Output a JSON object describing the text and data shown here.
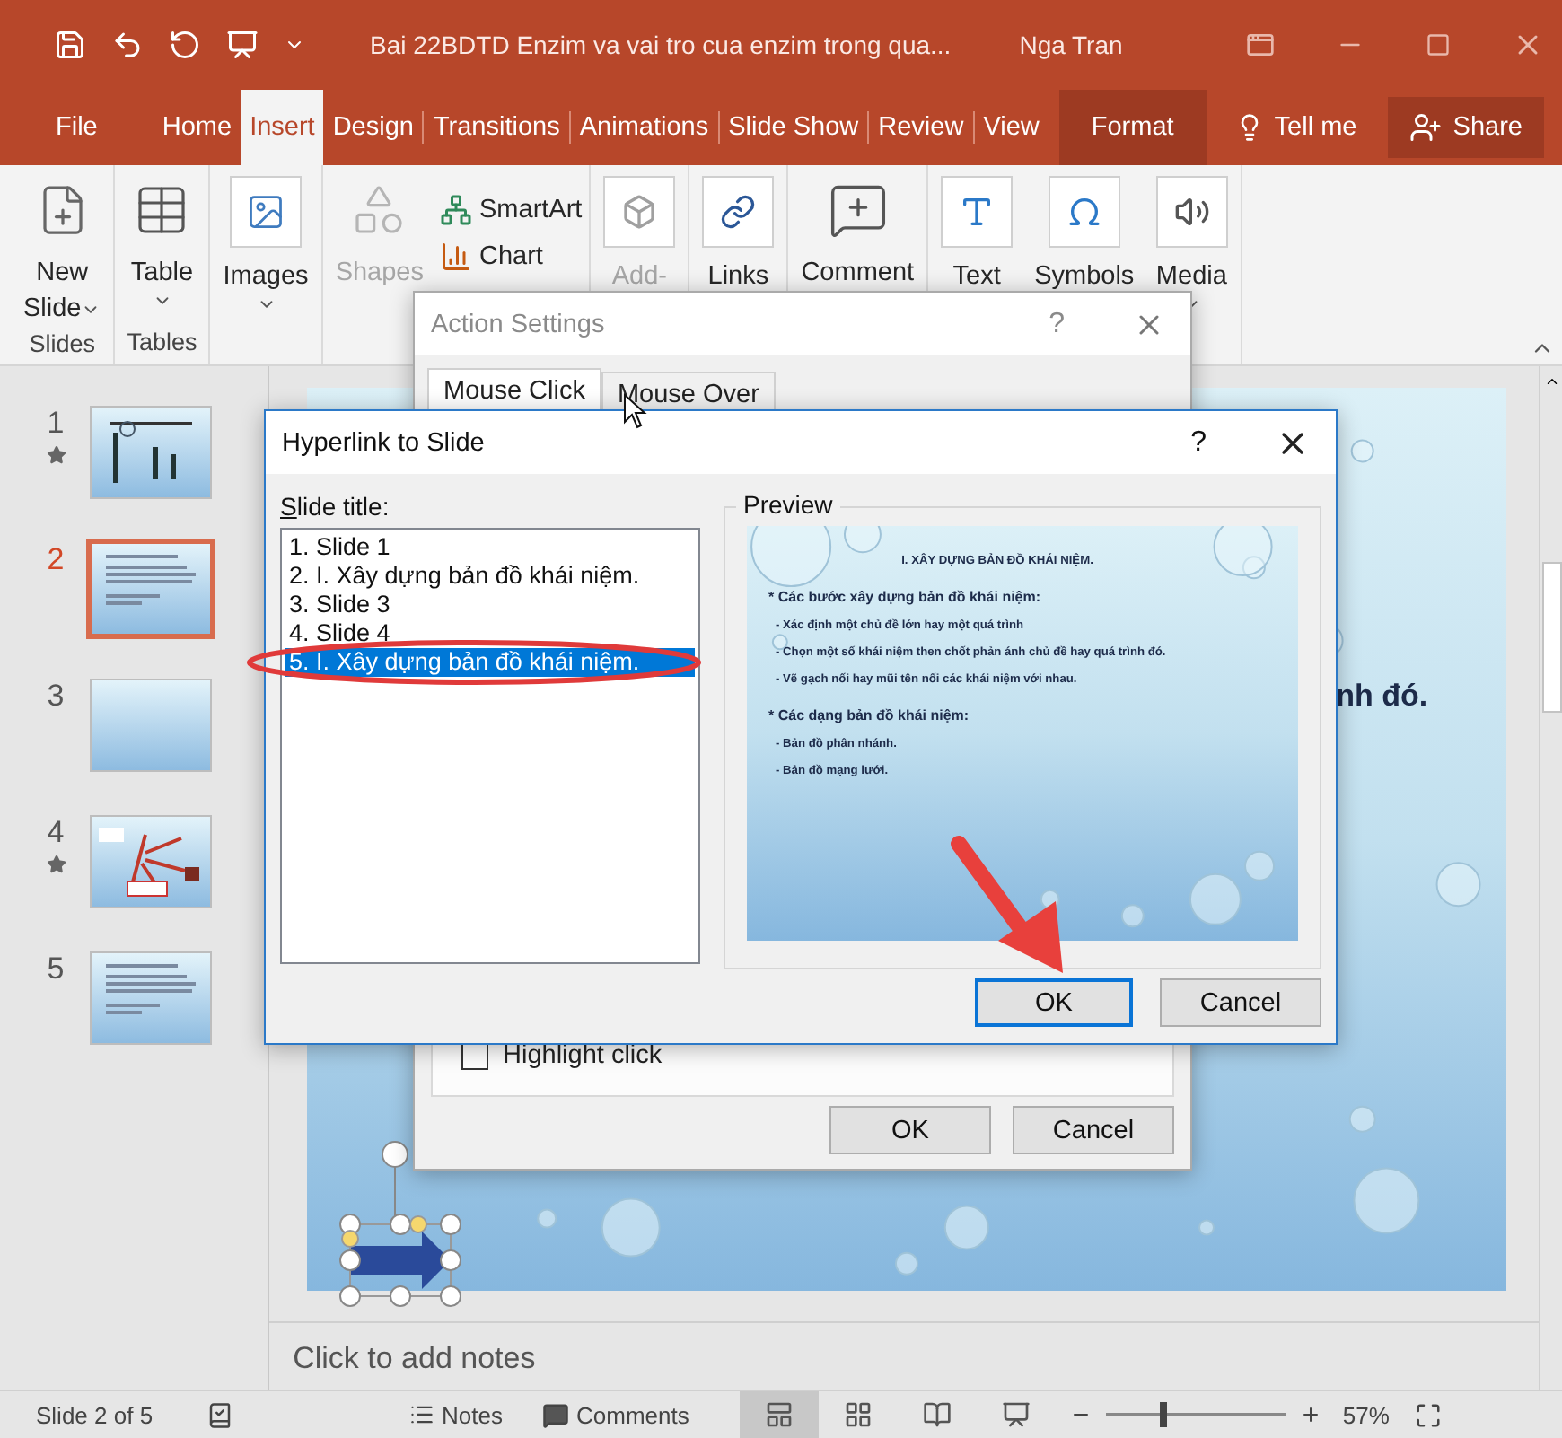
{
  "window": {
    "title": "Bai 22BDTD Enzim va vai tro cua enzim trong qua...",
    "user": "Nga Tran"
  },
  "ribbon_tabs": [
    {
      "label": "File",
      "selected": false,
      "kind": "tab"
    },
    {
      "label": "Home",
      "selected": false,
      "kind": "tab"
    },
    {
      "label": "Insert",
      "selected": true,
      "kind": "tab"
    },
    {
      "label": "Design",
      "selected": false,
      "kind": "tab"
    },
    {
      "label": "Transitions",
      "selected": false,
      "kind": "tab"
    },
    {
      "label": "Animations",
      "selected": false,
      "kind": "tab"
    },
    {
      "label": "Slide Show",
      "selected": false,
      "kind": "tab"
    },
    {
      "label": "Review",
      "selected": false,
      "kind": "tab"
    },
    {
      "label": "View",
      "selected": false,
      "kind": "tab"
    },
    {
      "label": "Format",
      "selected": false,
      "kind": "contextual"
    }
  ],
  "tell_me": "Tell me",
  "share": "Share",
  "ribbon_groups": [
    {
      "label": "Slides",
      "commands": [
        {
          "kind": "large",
          "lines": [
            "New",
            "Slide"
          ],
          "dropdown": true,
          "disabled": false
        }
      ]
    },
    {
      "label": "Tables",
      "commands": [
        {
          "kind": "large",
          "lines": [
            "Table"
          ],
          "dropdown": true,
          "disabled": false
        }
      ]
    },
    {
      "commands": [
        {
          "kind": "large",
          "lines": [
            "Images"
          ],
          "dropdown": true,
          "disabled": false
        }
      ]
    },
    {
      "commands": [
        {
          "kind": "large",
          "lines": [
            "Shapes"
          ],
          "dropdown": false,
          "disabled": true
        },
        {
          "kind": "small",
          "lines": [
            "SmartArt"
          ],
          "dropdown": false,
          "disabled": false
        },
        {
          "kind": "small",
          "lines": [
            "Chart"
          ],
          "dropdown": false,
          "disabled": false
        }
      ]
    },
    {
      "commands": [
        {
          "kind": "large",
          "lines": [
            "Add-"
          ],
          "dropdown": false,
          "disabled": true
        }
      ]
    },
    {
      "commands": [
        {
          "kind": "large",
          "lines": [
            "Links"
          ],
          "dropdown": false,
          "disabled": false
        }
      ]
    },
    {
      "commands": [
        {
          "kind": "large",
          "lines": [
            "Comment"
          ],
          "dropdown": false,
          "disabled": false
        }
      ]
    },
    {
      "commands": [
        {
          "kind": "large",
          "lines": [
            "Text"
          ],
          "dropdown": false,
          "disabled": false
        },
        {
          "kind": "large",
          "lines": [
            "Symbols"
          ],
          "dropdown": false,
          "disabled": false
        },
        {
          "kind": "large",
          "lines": [
            "Media"
          ],
          "dropdown": true,
          "disabled": false
        }
      ]
    }
  ],
  "slides_panel": [
    {
      "number": "1",
      "selected": false,
      "animated": true,
      "kind": "diagram"
    },
    {
      "number": "2",
      "selected": true,
      "animated": false,
      "kind": "text"
    },
    {
      "number": "3",
      "selected": false,
      "animated": false,
      "kind": "blank"
    },
    {
      "number": "4",
      "selected": false,
      "animated": true,
      "kind": "mindmap"
    },
    {
      "number": "5",
      "selected": false,
      "animated": false,
      "kind": "text"
    }
  ],
  "slide": {
    "text": "nh đó."
  },
  "notes": {
    "placeholder": "Click to add notes"
  },
  "action_settings": {
    "title": "Action Settings",
    "help": "?",
    "tabs": [
      {
        "label": "Mouse Click",
        "selected": true
      },
      {
        "label": "Mouse Over",
        "selected": false
      }
    ],
    "highlight_click": {
      "label": "Highlight click",
      "checked": false
    },
    "buttons": [
      "OK",
      "Cancel"
    ]
  },
  "hyperlink_dialog": {
    "title": "Hyperlink to Slide",
    "help": "?",
    "list_label": "Slide title:",
    "slides": [
      {
        "label": "1. Slide 1",
        "selected": false
      },
      {
        "label": "2. I. Xây dựng bản đồ khái niệm.",
        "selected": false
      },
      {
        "label": "3. Slide 3",
        "selected": false
      },
      {
        "label": "4. Slide 4",
        "selected": false
      },
      {
        "label": "5. I. Xây dựng bản đồ khái niệm.",
        "selected": true
      }
    ],
    "preview_label": "Preview",
    "preview": [
      {
        "kind": "title",
        "text": "I. XÂY DỰNG BẢN ĐỒ KHÁI NIỆM."
      },
      {
        "kind": "heading",
        "text": "* Các bước xây dựng bản đồ khái niệm:"
      },
      {
        "kind": "bullet",
        "text": "- Xác định một chủ đề lớn hay một quá trình"
      },
      {
        "kind": "bullet",
        "text": "- Chọn một số khái niệm then chốt phản ánh chủ đề hay quá trình đó."
      },
      {
        "kind": "bullet",
        "text": "- Vẽ gạch nối hay mũi tên nối các khái niệm với nhau."
      },
      {
        "kind": "heading",
        "text": "* Các dạng bản đồ khái niệm:"
      },
      {
        "kind": "bullet",
        "text": "- Bản đồ phân nhánh."
      },
      {
        "kind": "bullet",
        "text": "- Bản đồ mạng lưới."
      }
    ],
    "buttons": [
      {
        "label": "OK",
        "default": true
      },
      {
        "label": "Cancel",
        "default": false
      }
    ]
  },
  "status_bar": {
    "slide_info": "Slide 2 of 5",
    "notes": "Notes",
    "comments": "Comments",
    "views": [
      {
        "kind": "normal",
        "selected": true
      },
      {
        "kind": "sorter",
        "selected": false
      },
      {
        "kind": "reading",
        "selected": false
      },
      {
        "kind": "slideshow",
        "selected": false
      }
    ],
    "zoom": {
      "level": 0.3,
      "reading": "57%"
    }
  }
}
